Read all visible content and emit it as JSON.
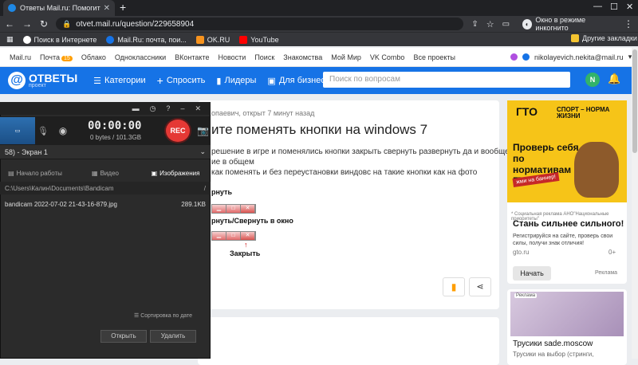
{
  "browser": {
    "tab_title": "Ответы Mail.ru: Помогите поменять",
    "new_tab": "+",
    "url": "otvet.mail.ru/question/229658904",
    "incognito_label": "Окно в режиме инкогнито",
    "bookmarks": [
      "Поиск в Интернете",
      "Mail.Ru: почта, пои...",
      "OK.RU",
      "YouTube"
    ],
    "other_bookmarks": "Другие закладки"
  },
  "mailnav": {
    "items": [
      "Mail.ru",
      "Почта",
      "Облако",
      "Одноклассники",
      "ВКонтакте",
      "Новости",
      "Поиск",
      "Знакомства",
      "Мой Мир",
      "VK Combo",
      "Все проекты"
    ],
    "mail_badge": "15",
    "account": "nikolayevich.nekita@mail.ru"
  },
  "header": {
    "logo_name": "ОТВЕТЫ",
    "logo_sub": "проект",
    "nav": [
      "Категории",
      "Спросить",
      "Лидеры",
      "Для бизнеса"
    ],
    "search_placeholder": "Поиск по вопросам",
    "avatar_letter": "N"
  },
  "question": {
    "meta": "опаевич, открыт 7 минут назад",
    "title": "ите поменять кнопки на windows 7",
    "lines": [
      "решение в игре и поменялись кнопки закрыть свернуть развернуть да и вообще",
      "ие в общем",
      "как поменять и без переустановки виндовс на такие кнопки как на фото"
    ],
    "ill_label_1": "рнуть",
    "ill_label_2": "рнуть/Свернуть в окно",
    "ill_label_3": "Закрыть"
  },
  "ad1": {
    "logo_gto": "ГТО",
    "logo_sport": "СПОРТ – НОРМА ЖИЗНИ",
    "headline": "Проверь себя по нормативам ГТО",
    "tag": "жми на баннер!",
    "small": "* Социальная реклама АНО\"Национальные приоритеты\"",
    "title": "Стань сильнее сильного!",
    "body": "Регистрируйся на сайте, проверь свои силы, получи знак отличия!",
    "domain": "gto.ru",
    "age": "0+",
    "button": "Начать",
    "label": "Реклама"
  },
  "ad2": {
    "tag": "Реклама",
    "title": "Трусики sade.moscow",
    "body": "Трусики на выбор (стринги,"
  },
  "bandicam": {
    "timer": "00:00:00",
    "size": "0 bytes / 101.3GB",
    "rec": "REC",
    "mode": "58) - Экран 1",
    "tabs": [
      "Начало работы",
      "Видео",
      "Изображения"
    ],
    "path": "C:\\Users\\Калин\\Documents\\Bandicam",
    "path_btn": "/",
    "file_name": "bandicam 2022-07-02 21-43-16-879.jpg",
    "file_size": "289.1KB",
    "sort": "Сортировка по дате",
    "open": "Открыть",
    "delete": "Удалить"
  }
}
